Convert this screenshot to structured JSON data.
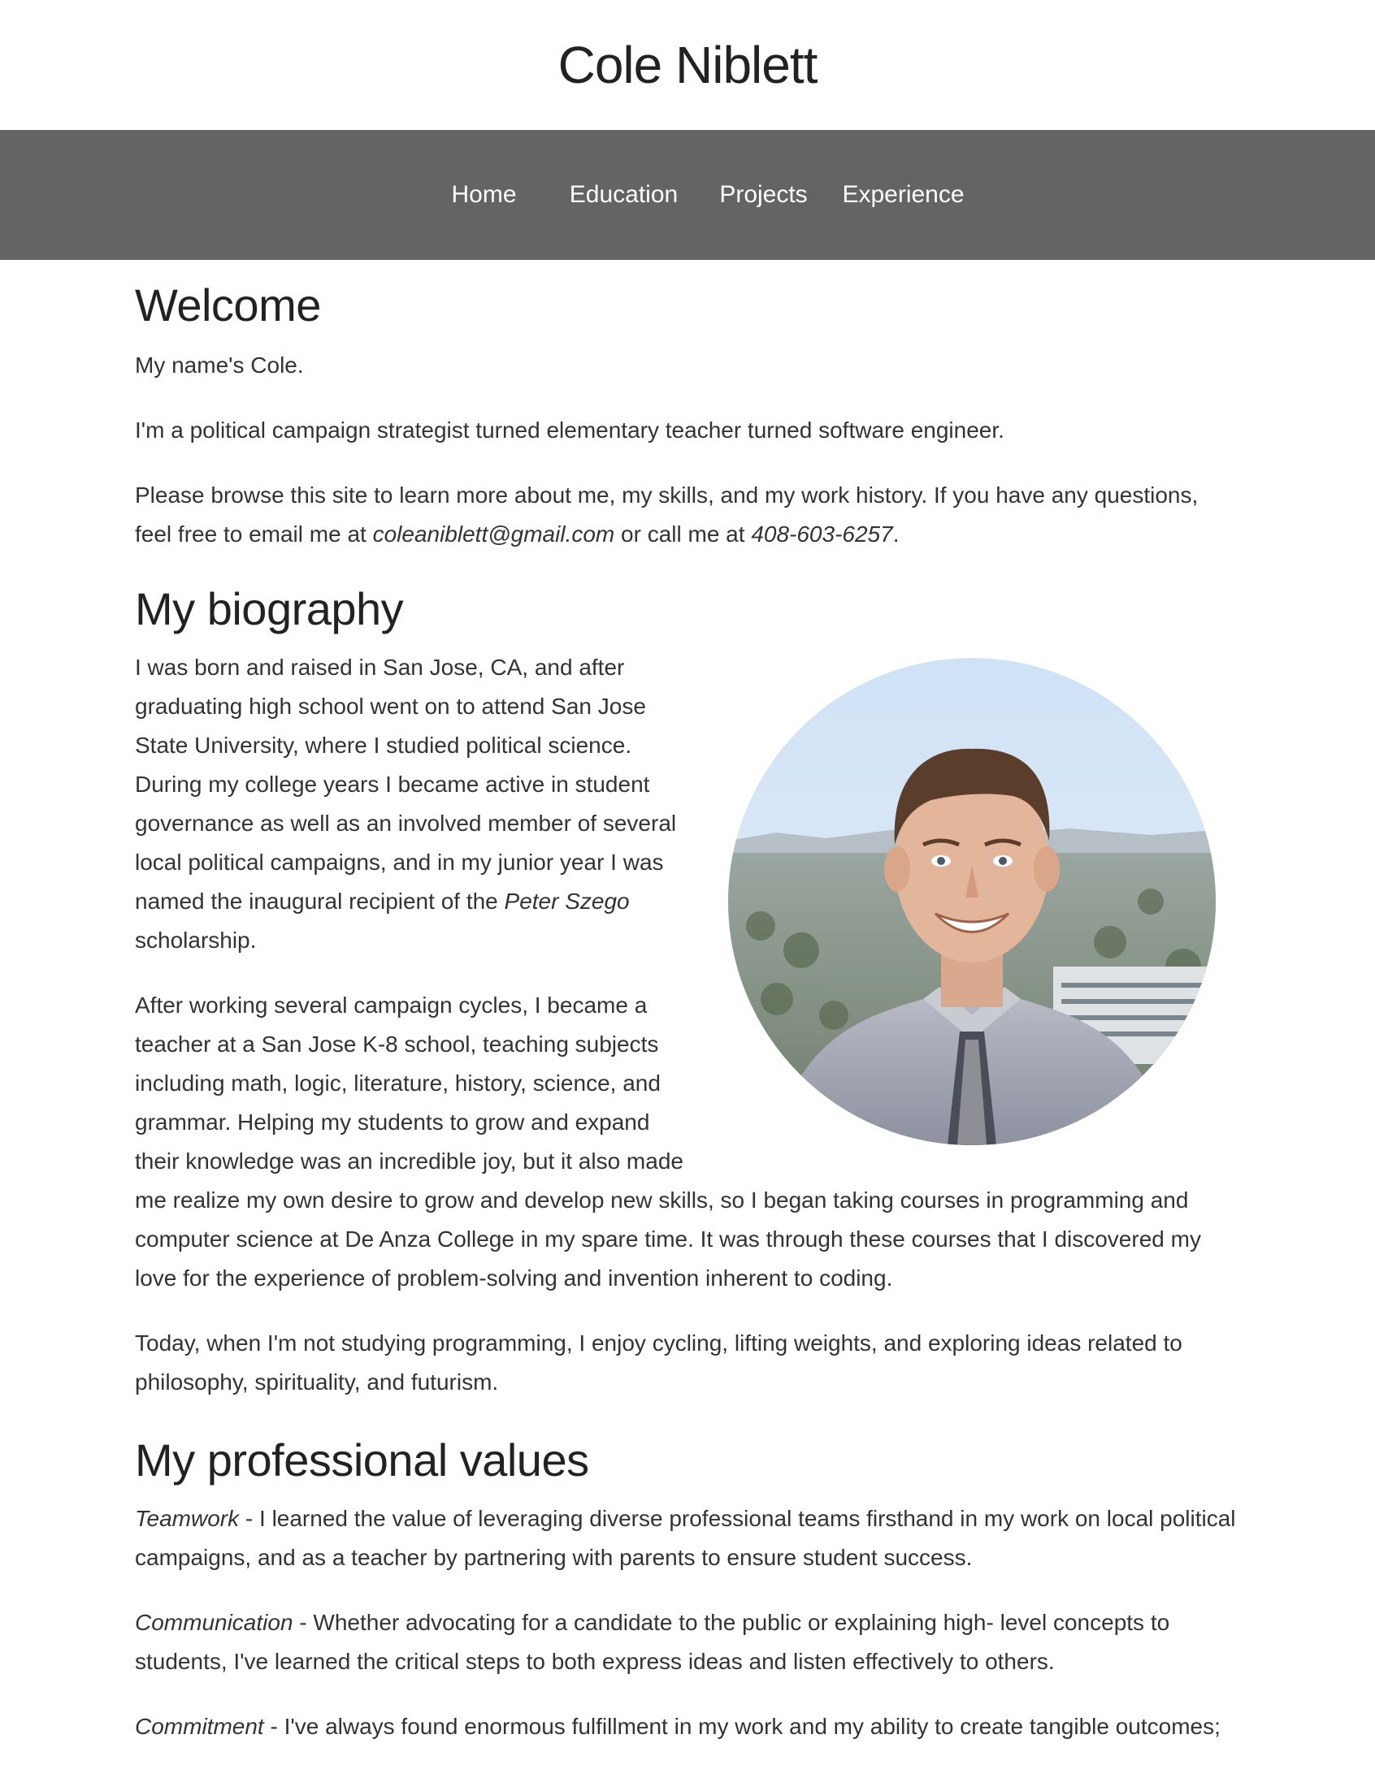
{
  "site": {
    "title": "Cole Niblett"
  },
  "nav": {
    "items": [
      {
        "label": "Home"
      },
      {
        "label": "Education"
      },
      {
        "label": "Projects"
      },
      {
        "label": "Experience"
      }
    ]
  },
  "welcome": {
    "heading": "Welcome",
    "p1": "My name's Cole.",
    "p2": "I'm a political campaign strategist turned elementary teacher turned software engineer.",
    "p3_before": "Please browse this site to learn more about me, my skills, and my work history. If you have any questions, feel free to email me at ",
    "email": "coleaniblett@gmail.com",
    "p3_middle": " or call me at ",
    "phone": "408-603-6257",
    "p3_after": "."
  },
  "biography": {
    "heading": "My biography",
    "p1_before": "I was born and raised in San Jose, CA, and after graduating high school went on to attend San Jose State University, where I studied political science. During my college years I became active in student governance as well as an involved member of several local political campaigns, and in my junior year I was named the inaugural recipient of the ",
    "scholarship": "Peter Szego",
    "p1_after": " scholarship.",
    "p2": "After working several campaign cycles, I became a teacher at a San Jose K-8 school, teaching subjects including math, logic, literature, history, science, and grammar. Helping my students to grow and expand their knowledge was an incredible joy, but it also made me realize my own desire to grow and develop new skills, so I began taking courses in programming and computer science at De Anza College in my spare time. It was through these courses that I discovered my love for the experience of problem-solving and invention inherent to coding.",
    "p3": "Today, when I'm not studying programming, I enjoy cycling, lifting weights, and exploring ideas related to philosophy, spirituality, and futurism."
  },
  "values": {
    "heading": "My professional values",
    "items": [
      {
        "term": "Teamwork",
        "text": " - I learned the value of leveraging diverse professional teams firsthand in my work on local political campaigns, and as a teacher by partnering with parents to ensure student success."
      },
      {
        "term": "Communication",
        "text": " - Whether advocating for a candidate to the public or explaining high- level concepts to students, I've learned the critical steps to both express ideas and listen effectively to others."
      },
      {
        "term": "Commitment",
        "text": " - I've always found enormous fulfillment in my work and my ability to create tangible outcomes;"
      }
    ]
  },
  "colors": {
    "navbar": "#626466",
    "nav_text": "#ffffff",
    "heading": "#222222",
    "body_text": "#333333"
  },
  "icons": {
    "portrait": "portrait-photo"
  }
}
